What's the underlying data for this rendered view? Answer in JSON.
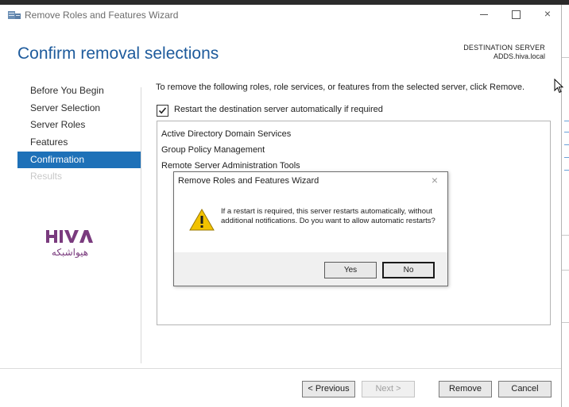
{
  "window": {
    "title": "Remove Roles and Features Wizard",
    "controls": {
      "minimize": "minimize-icon",
      "maximize": "maximize-icon",
      "close": "×"
    }
  },
  "page": {
    "heading": "Confirm removal selections",
    "destination_label": "DESTINATION SERVER",
    "destination_value": "ADDS.hiva.local"
  },
  "nav": {
    "items": [
      {
        "label": "Before You Begin",
        "state": "normal"
      },
      {
        "label": "Server Selection",
        "state": "normal"
      },
      {
        "label": "Server Roles",
        "state": "normal"
      },
      {
        "label": "Features",
        "state": "normal"
      },
      {
        "label": "Confirmation",
        "state": "active"
      },
      {
        "label": "Results",
        "state": "disabled"
      }
    ]
  },
  "logo": {
    "mark": "HIVA",
    "subtitle": "هیواشبکه"
  },
  "content": {
    "instruction": "To remove the following roles, role services, or features from the selected server, click Remove.",
    "restart_checkbox": {
      "label": "Restart the destination server automatically if required",
      "checked": true
    },
    "items": [
      "Active Directory Domain Services",
      "Group Policy Management",
      "Remote Server Administration Tools"
    ]
  },
  "dialog": {
    "title": "Remove Roles and Features Wizard",
    "close": "×",
    "icon": "warning-icon",
    "message": "If a restart is required, this server restarts automatically, without additional notifications. Do you want to allow automatic restarts?",
    "yes_label": "Yes",
    "no_label": "No"
  },
  "footer": {
    "previous_label": "< Previous",
    "next_label": "Next >",
    "remove_label": "Remove",
    "cancel_label": "Cancel"
  },
  "colors": {
    "accent": "#1e71b8",
    "heading": "#1e5b9c",
    "logo": "#7a3b7e",
    "warning": "#f2c200"
  }
}
